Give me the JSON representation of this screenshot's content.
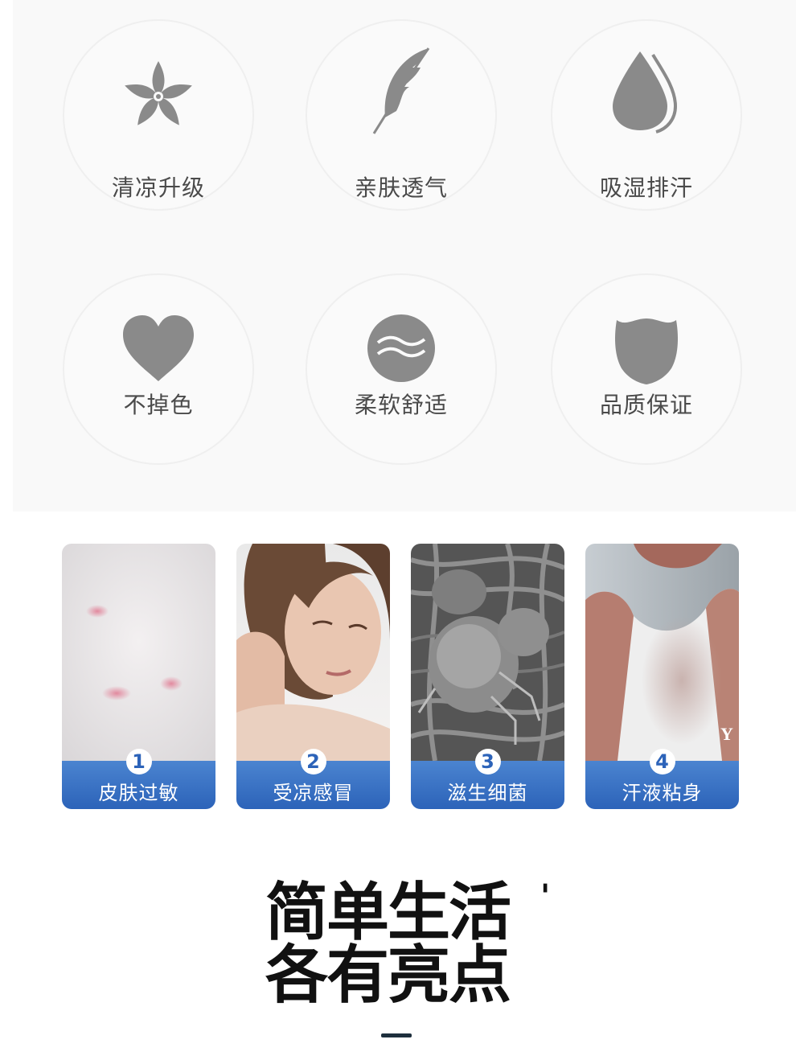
{
  "features": [
    {
      "label": "清凉升级",
      "icon": "flower-icon"
    },
    {
      "label": "亲肤透气",
      "icon": "feather-icon"
    },
    {
      "label": "吸湿排汗",
      "icon": "water-drop-icon"
    },
    {
      "label": "不掉色",
      "icon": "heart-icon"
    },
    {
      "label": "柔软舒适",
      "icon": "wave-circle-icon"
    },
    {
      "label": "品质保证",
      "icon": "shield-icon"
    }
  ],
  "icon_color": "#8a8a8a",
  "problems": [
    {
      "number": "1",
      "label": "皮肤过敏",
      "image": "skin-rash-photo"
    },
    {
      "number": "2",
      "label": "受凉感冒",
      "image": "woman-neck-pain-photo"
    },
    {
      "number": "3",
      "label": "滋生细菌",
      "image": "dust-mite-photo"
    },
    {
      "number": "4",
      "label": "汗液粘身",
      "image": "sweaty-back-photo"
    }
  ],
  "problem_watermark": "Y",
  "accent_color": "#2c63b9",
  "slogan": {
    "line1": "简单生活",
    "line2": "各有亮点",
    "mark": "'"
  }
}
